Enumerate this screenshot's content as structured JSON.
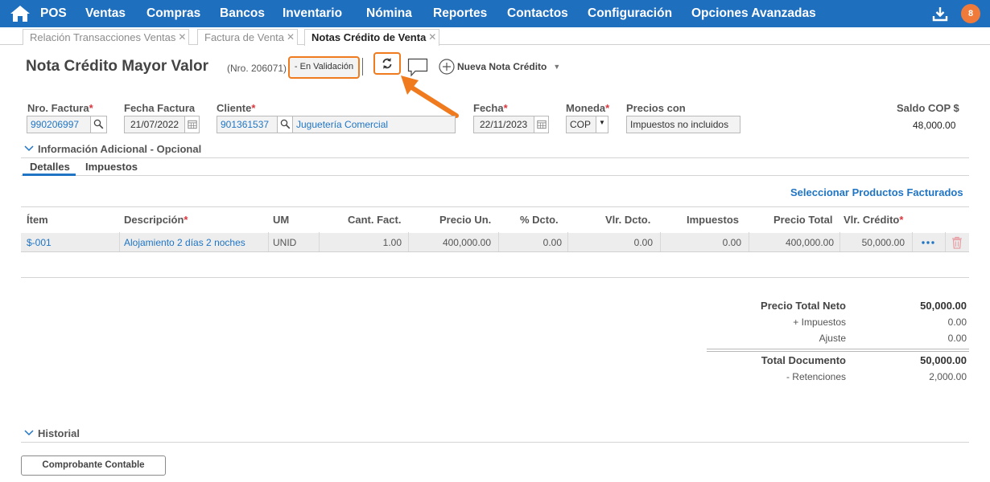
{
  "nav": {
    "items": [
      "POS",
      "Ventas",
      "Compras",
      "Bancos",
      "Inventario",
      "Nómina",
      "Reportes",
      "Contactos",
      "Configuración",
      "Opciones Avanzadas"
    ],
    "notifications": "8"
  },
  "tabs": [
    {
      "label": "Relación Transacciones Ventas"
    },
    {
      "label": "Factura de Venta"
    },
    {
      "label": "Notas Crédito de Venta"
    }
  ],
  "header": {
    "title": "Nota Crédito Mayor Valor",
    "number": "(Nro. 206071)",
    "status": "- En Validación",
    "new_note": "Nueva Nota Crédito"
  },
  "form": {
    "invoice_no_label": "Nro. Factura",
    "invoice_no": "990206997",
    "invoice_date_label": "Fecha Factura",
    "invoice_date": "21/07/2022",
    "client_label": "Cliente",
    "client_id": "901361537",
    "client_name": "Juguetería Comercial",
    "date_label": "Fecha",
    "date": "22/11/2023",
    "currency_label": "Moneda",
    "currency": "COP",
    "prices_label": "Precios con",
    "prices": "Impuestos no incluidos",
    "balance_label": "Saldo COP $",
    "balance": "48,000.00"
  },
  "sections": {
    "additional": "Información Adicional - Opcional",
    "history": "Historial"
  },
  "subtabs": {
    "details": "Detalles",
    "taxes": "Impuestos"
  },
  "grid": {
    "select_products": "Seleccionar Productos Facturados",
    "headers": [
      "Ítem",
      "Descripción",
      "UM",
      "Cant. Fact.",
      "Precio Un.",
      "% Dcto.",
      "Vlr. Dcto.",
      "Impuestos",
      "Precio Total",
      "Vlr. Crédito"
    ],
    "rows": [
      {
        "item": "$-001",
        "description": "Alojamiento 2 días 2 noches",
        "um": "UNID",
        "qty": "1.00",
        "unit_price": "400,000.00",
        "disc_pct": "0.00",
        "disc_val": "0.00",
        "taxes": "0.00",
        "total": "400,000.00",
        "credit": "50,000.00"
      }
    ]
  },
  "totals": {
    "net_label": "Precio Total Neto",
    "net": "50,000.00",
    "taxes_label": "+ Impuestos",
    "taxes": "0.00",
    "adjust_label": "Ajuste",
    "adjust": "0.00",
    "doc_label": "Total Documento",
    "doc": "50,000.00",
    "ret_label": "- Retenciones",
    "ret": "2,000.00"
  },
  "buttons": {
    "comprobante": "Comprobante Contable"
  },
  "colors": {
    "nav_bg": "#1f6fbf",
    "accent": "#f07a1e",
    "link": "#1f75c4",
    "required": "#d9363e"
  }
}
